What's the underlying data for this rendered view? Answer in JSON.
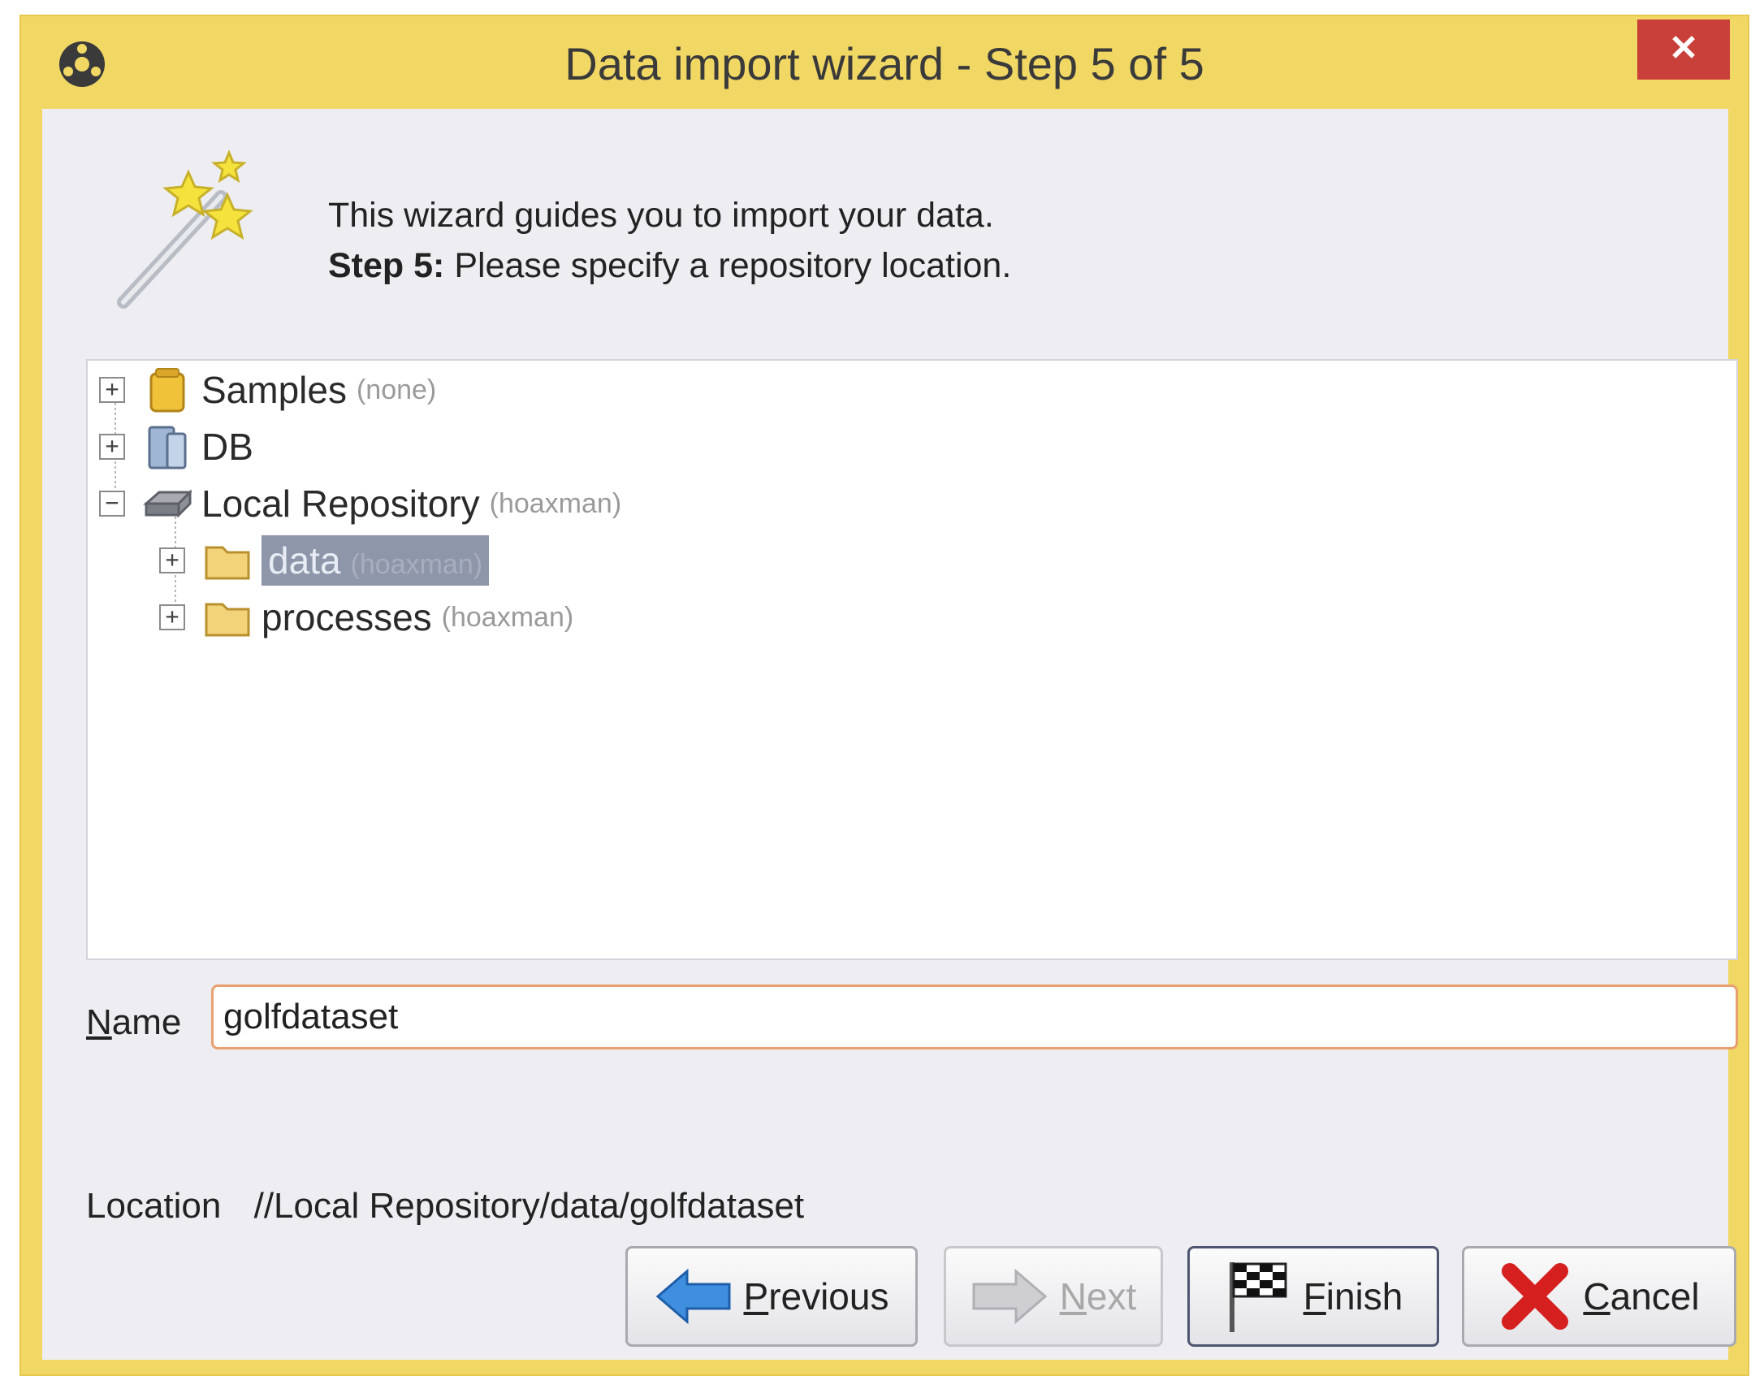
{
  "window": {
    "title": "Data import wizard - Step 5 of 5",
    "close_label": "✕"
  },
  "intro": {
    "line1": "This wizard guides you to import your data.",
    "step_label": "Step 5:",
    "step_text": " Please specify a repository location."
  },
  "tree": {
    "nodes": [
      {
        "label": "Samples",
        "sub": "(none)",
        "expander": "+"
      },
      {
        "label": "DB",
        "sub": "",
        "expander": "+"
      },
      {
        "label": "Local Repository",
        "sub": "(hoaxman)",
        "expander": "−"
      },
      {
        "label": "data",
        "sub": "(hoaxman)",
        "expander": "+",
        "selected": true
      },
      {
        "label": "processes",
        "sub": "(hoaxman)",
        "expander": "+"
      }
    ]
  },
  "name_field": {
    "label_mnemonic": "N",
    "label_rest": "ame",
    "value": "golfdataset"
  },
  "location": {
    "label": "Location",
    "value": "//Local Repository/data/golfdataset"
  },
  "buttons": {
    "previous": {
      "mnemonic": "P",
      "rest": "revious"
    },
    "next": {
      "mnemonic": "N",
      "rest": "ext"
    },
    "finish": {
      "mnemonic": "F",
      "rest": "inish"
    },
    "cancel": {
      "mnemonic": "C",
      "rest": "ancel"
    }
  },
  "colors": {
    "frame": "#f1d764",
    "close_button": "#c9403a",
    "selection": "#8e96aa",
    "input_border": "#e8a070"
  }
}
